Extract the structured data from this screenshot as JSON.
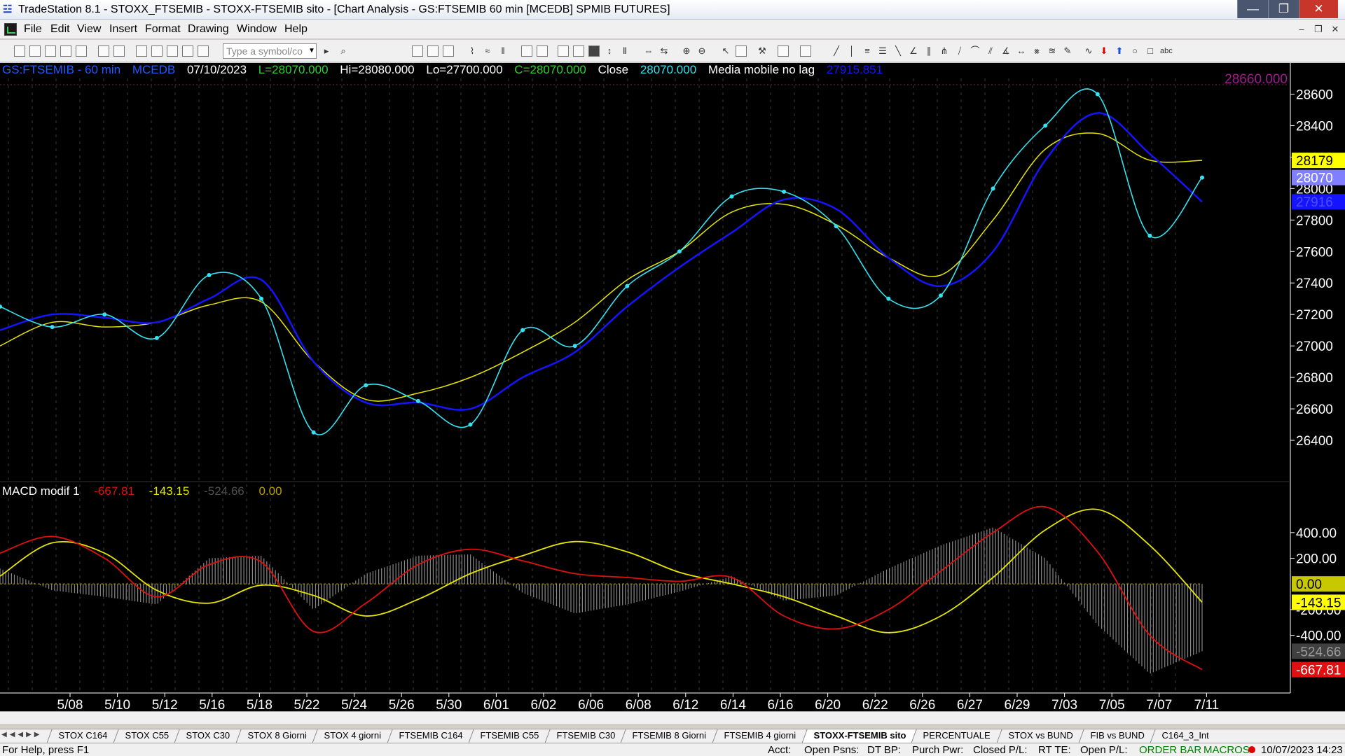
{
  "window": {
    "title": "TradeStation 8.1 - STOXX_FTSEMIB - STOXX-FTSEMIB sito - [Chart Analysis - GS:FTSEMIB  60 min  [MCEDB] SPMIB FUTURES]",
    "minimize": "—",
    "maximize": "❐",
    "close": "✕"
  },
  "menu": {
    "items": [
      "File",
      "Edit",
      "View",
      "Insert",
      "Format",
      "Drawing",
      "Window",
      "Help"
    ],
    "mdi_controls": [
      "–",
      "❐",
      "✕"
    ]
  },
  "toolbar": {
    "symbol_placeholder": "Type a symbol/co",
    "dropdown_arrow": "▼"
  },
  "chart": {
    "info": {
      "symbol": "GS:FTSEMIB - 60 min",
      "exchange": "MCEDB",
      "date": "07/10/2023",
      "last": "L=28070.000",
      "high": "Hi=28080.000",
      "low": "Lo=27700.000",
      "close_value": "C=28070.000",
      "close_label": "Close",
      "close_price": "28070.000",
      "indicator": "Media mobile no lag",
      "indicator_value": "27915.851"
    },
    "top_right_value": "28660.000",
    "macd_info": {
      "name": "MACD modif 1",
      "v1": "-667.81",
      "v2": "-143.15",
      "v3": "-524.66",
      "v4": "0.00"
    },
    "colors": {
      "price": "#34e2f0",
      "ma_fast": "#1414ff",
      "ma_slow": "#e6e600",
      "macd": "#e01010",
      "signal": "#e6e600",
      "hist": "#8a8a8a",
      "axis_text": "#ffffff"
    },
    "price_axis": {
      "ticks": [
        "28600",
        "28400",
        "28200",
        "28000",
        "27800",
        "27600",
        "27400",
        "27200",
        "27000",
        "26800",
        "26600",
        "26400"
      ],
      "tags": [
        {
          "text": "28179",
          "bg": "#ffff00",
          "fg": "#000000"
        },
        {
          "text": "28070",
          "bg": "#7f7fff",
          "fg": "#ffffff"
        },
        {
          "text": "27916",
          "bg": "#1414ff",
          "fg": "#5050ff"
        }
      ]
    },
    "macd_axis": {
      "ticks": [
        "400.00",
        "200.00",
        "-200.00",
        "-400.00"
      ],
      "tags": [
        {
          "text": "0.00",
          "bg": "#c8c800",
          "fg": "#000000"
        },
        {
          "text": "-143.15",
          "bg": "#ffff00",
          "fg": "#000000"
        },
        {
          "text": "-524.66",
          "bg": "#404040",
          "fg": "#9a9a9a"
        },
        {
          "text": "-667.81",
          "bg": "#e01010",
          "fg": "#ffffff"
        }
      ]
    },
    "date_labels": [
      "5/08",
      "5/10",
      "5/12",
      "5/16",
      "5/18",
      "5/22",
      "5/24",
      "5/26",
      "5/30",
      "6/01",
      "6/02",
      "6/06",
      "6/08",
      "6/12",
      "6/14",
      "6/16",
      "6/20",
      "6/22",
      "6/26",
      "6/27",
      "6/29",
      "7/03",
      "7/05",
      "7/07",
      "7/11"
    ]
  },
  "chart_data": [
    {
      "type": "line",
      "title": "GS:FTSEMIB - 60 min",
      "ylim": [
        26200,
        28700
      ],
      "x": [
        "5/08",
        "5/10",
        "5/12",
        "5/16",
        "5/18",
        "5/22",
        "5/24",
        "5/26",
        "5/30",
        "6/01",
        "6/02",
        "6/06",
        "6/08",
        "6/12",
        "6/14",
        "6/16",
        "6/20",
        "6/22",
        "6/26",
        "6/27",
        "6/29",
        "7/03",
        "7/05",
        "7/07"
      ],
      "series": [
        {
          "name": "Close",
          "values": [
            27250,
            27120,
            27200,
            27050,
            27450,
            27300,
            26450,
            26750,
            26650,
            26500,
            27100,
            27000,
            27380,
            27600,
            27950,
            27980,
            27760,
            27300,
            27320,
            28000,
            28400,
            28600,
            27700,
            28070
          ]
        },
        {
          "name": "Media mobile no lag",
          "values": [
            27100,
            27200,
            27180,
            27150,
            27300,
            27420,
            26900,
            26640,
            26640,
            26600,
            26800,
            26960,
            27250,
            27500,
            27720,
            27930,
            27870,
            27560,
            27380,
            27600,
            28180,
            28480,
            28220,
            27916
          ]
        },
        {
          "values": [
            27000,
            27150,
            27120,
            27150,
            27260,
            27280,
            26900,
            26660,
            26700,
            26800,
            26960,
            27150,
            27420,
            27600,
            27850,
            27900,
            27770,
            27560,
            27450,
            27800,
            28250,
            28350,
            28180,
            28179
          ]
        }
      ]
    },
    {
      "type": "line",
      "title": "MACD modif 1",
      "ylim": [
        -850,
        650
      ],
      "x": [
        "5/08",
        "5/10",
        "5/12",
        "5/16",
        "5/18",
        "5/22",
        "5/24",
        "5/26",
        "5/30",
        "6/01",
        "6/02",
        "6/06",
        "6/08",
        "6/12",
        "6/14",
        "6/16",
        "6/20",
        "6/22",
        "6/26",
        "6/27",
        "6/29",
        "7/03",
        "7/05",
        "7/07"
      ],
      "series": [
        {
          "values": [
            240,
            370,
            200,
            -100,
            150,
            170,
            -370,
            -150,
            150,
            270,
            180,
            80,
            50,
            20,
            50,
            -250,
            -350,
            -200,
            100,
            400,
            600,
            250,
            -400,
            -667.81
          ]
        },
        {
          "values": [
            60,
            320,
            240,
            -50,
            -150,
            -10,
            -90,
            -250,
            -120,
            80,
            220,
            330,
            250,
            90,
            0,
            -100,
            -250,
            -380,
            -250,
            50,
            420,
            580,
            300,
            -143.15
          ]
        },
        {
          "type": "bar",
          "values": [
            120,
            -50,
            -100,
            -160,
            200,
            220,
            -200,
            80,
            220,
            230,
            -70,
            -230,
            -160,
            -60,
            60,
            -130,
            -90,
            120,
            300,
            440,
            200,
            -320,
            -700,
            -524.66
          ]
        }
      ]
    }
  ],
  "tabs": {
    "nav": "◀◀◀▶▶",
    "items": [
      "STOX C164",
      "STOX C55",
      "STOX  C30",
      "STOX  8 Giorni",
      "STOX 4 giorni",
      "FTSEMIB C164",
      "FTSEMIB C55",
      "FTSEMIB C30",
      "FTSEMIB  8 Giorni",
      "FTSEMIB  4 giorni",
      "STOXX-FTSEMIB sito",
      "PERCENTUALE",
      "STOX vs BUND",
      "FIB vs BUND",
      "C164_3_Int"
    ],
    "active": "STOXX-FTSEMIB sito"
  },
  "status": {
    "help": "For Help, press F1",
    "fields": [
      "Acct:",
      "Open Psns:",
      "DT BP:",
      "Purch Pwr:",
      "Closed P/L:",
      "RT TE:",
      "Open P/L:"
    ],
    "order_bar": "ORDER BAR",
    "macros": "MACROS",
    "datetime": "10/07/2023 14:23"
  }
}
